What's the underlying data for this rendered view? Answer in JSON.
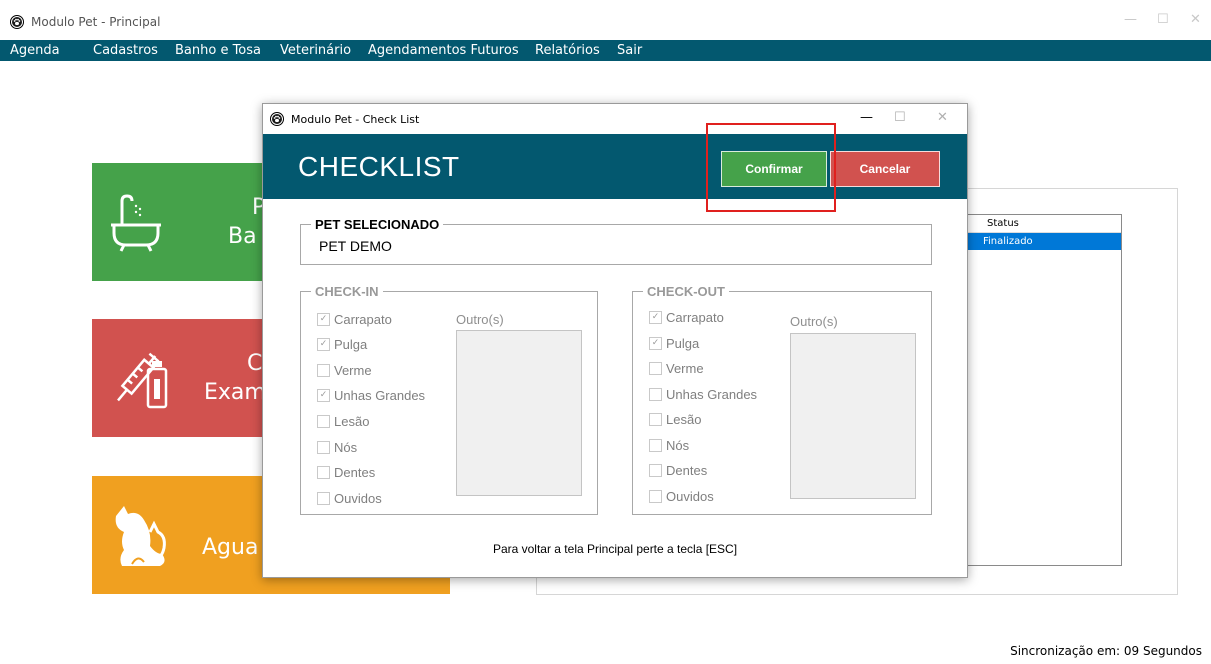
{
  "app": {
    "title": "Modulo Pet - Principal",
    "menu": [
      "Agenda",
      "Cadastros",
      "Banho e Tosa",
      "Veterinário",
      "Agendamentos Futuros",
      "Relatórios",
      "Sair"
    ],
    "window_controls": {
      "minimize": "—",
      "maximize": "☐",
      "close": "✕"
    }
  },
  "tiles": [
    {
      "line1": "P",
      "line2": "Ba",
      "color": "#45a24a",
      "icon": "bathtub-icon"
    },
    {
      "line1": "C",
      "line2": "Exam",
      "color": "#d1524f",
      "icon": "syringe-bottle-icon"
    },
    {
      "line1": "Agua",
      "line2": "",
      "color": "#f0a020",
      "icon": "dog-cat-icon"
    }
  ],
  "background_table": {
    "header": "Status",
    "rows": [
      "Finalizado"
    ]
  },
  "sync_status": "Sincronização em: 09 Segundos",
  "dialog": {
    "title": "Modulo Pet - Check List",
    "heading": "CHECKLIST",
    "confirm_label": "Confirmar",
    "cancel_label": "Cancelar",
    "confirm_color": "#45a24a",
    "cancel_color": "#d1524f",
    "header_color": "#03586f",
    "pet_section_label": "PET SELECIONADO",
    "pet_name": "PET DEMO",
    "checkin": {
      "label": "CHECK-IN",
      "others_label": "Outro(s)",
      "items": [
        {
          "label": "Carrapato",
          "checked": true
        },
        {
          "label": "Pulga",
          "checked": true
        },
        {
          "label": "Verme",
          "checked": false
        },
        {
          "label": "Unhas Grandes",
          "checked": true
        },
        {
          "label": "Lesão",
          "checked": false
        },
        {
          "label": "Nós",
          "checked": false
        },
        {
          "label": "Dentes",
          "checked": false
        },
        {
          "label": "Ouvidos",
          "checked": false
        }
      ]
    },
    "checkout": {
      "label": "CHECK-OUT",
      "others_label": "Outro(s)",
      "items": [
        {
          "label": "Carrapato",
          "checked": true
        },
        {
          "label": "Pulga",
          "checked": true
        },
        {
          "label": "Verme",
          "checked": false
        },
        {
          "label": "Unhas Grandes",
          "checked": false
        },
        {
          "label": "Lesão",
          "checked": false
        },
        {
          "label": "Nós",
          "checked": false
        },
        {
          "label": "Dentes",
          "checked": false
        },
        {
          "label": "Ouvidos",
          "checked": false
        }
      ]
    },
    "footer": "Para voltar a tela Principal perte a tecla [ESC]"
  }
}
